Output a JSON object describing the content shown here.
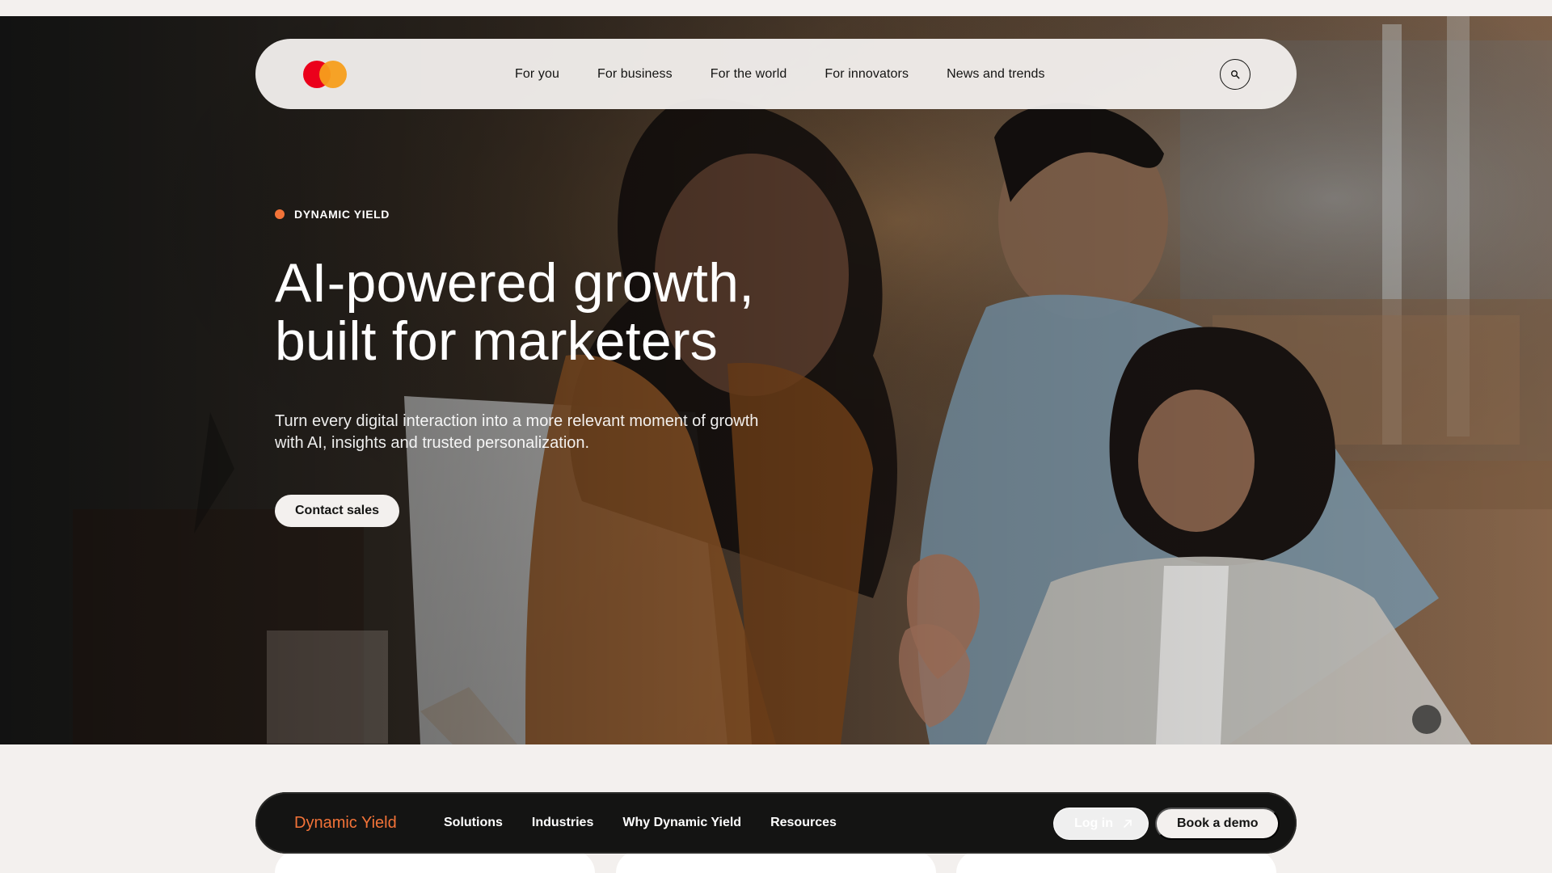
{
  "top_nav": {
    "logo_name": "mastercard-logo",
    "links": [
      "For you",
      "For business",
      "For the world",
      "For innovators",
      "News and trends"
    ],
    "search_icon": "search-icon"
  },
  "hero": {
    "eyebrow": "DYNAMIC YIELD",
    "title": "AI-powered growth, built for marketers",
    "subtitle": "Turn every digital interaction into a more relevant moment of growth with AI, insights and trusted personalization.",
    "cta_label": "Contact sales"
  },
  "sub_nav": {
    "brand": "Dynamic Yield",
    "links": [
      "Solutions",
      "Industries",
      "Why Dynamic Yield",
      "Resources"
    ],
    "login_label": "Log in",
    "login_icon": "arrow-up-right-icon",
    "demo_label": "Book a demo"
  },
  "colors": {
    "page_background": "#f3f0ee",
    "brand_orange": "#f37338",
    "mastercard_red": "#eb001b",
    "mastercard_yellow": "#f79e1b",
    "dark_nav": "#141413"
  }
}
